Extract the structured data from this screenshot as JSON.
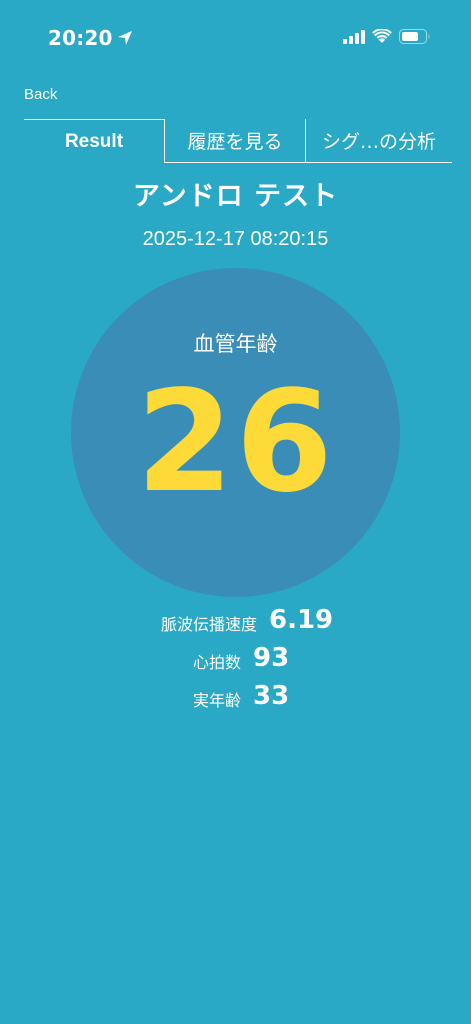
{
  "status_bar": {
    "time": "20:20"
  },
  "nav": {
    "back_label": "Back"
  },
  "tabs": [
    {
      "label": "Result",
      "active": true
    },
    {
      "label": "履歴を見る",
      "active": false
    },
    {
      "label": "シグ…の分析",
      "active": false
    }
  ],
  "header": {
    "title": "アンドロ テスト",
    "timestamp": "2025-12-17 08:20:15"
  },
  "main": {
    "circle_label": "血管年齢",
    "circle_value": "26"
  },
  "metrics": [
    {
      "label": "脈波伝播速度",
      "value": "6.19"
    },
    {
      "label": "心拍数",
      "value": "93"
    },
    {
      "label": "実年齢",
      "value": "33"
    }
  ],
  "colors": {
    "background": "#29A9C5",
    "circle": "#3A8DB6",
    "accent_value": "#FDDA38",
    "text": "#FFFFFF"
  },
  "icons": [
    "location-arrow-icon",
    "cellular-signal-icon",
    "wifi-icon",
    "battery-icon"
  ]
}
